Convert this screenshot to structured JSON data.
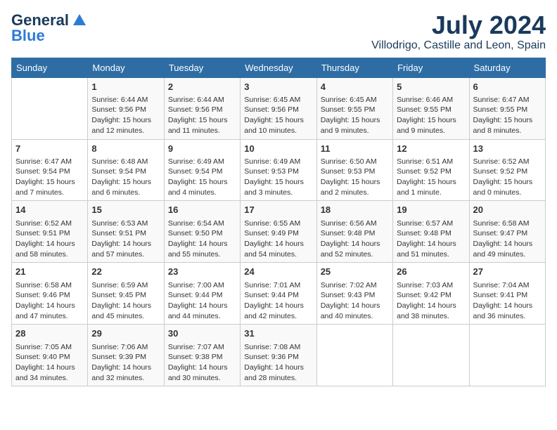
{
  "header": {
    "logo_line1": "General",
    "logo_line2": "Blue",
    "month": "July 2024",
    "location": "Villodrigo, Castille and Leon, Spain"
  },
  "days_of_week": [
    "Sunday",
    "Monday",
    "Tuesday",
    "Wednesday",
    "Thursday",
    "Friday",
    "Saturday"
  ],
  "weeks": [
    [
      {
        "day": "",
        "content": ""
      },
      {
        "day": "1",
        "content": "Sunrise: 6:44 AM\nSunset: 9:56 PM\nDaylight: 15 hours\nand 12 minutes."
      },
      {
        "day": "2",
        "content": "Sunrise: 6:44 AM\nSunset: 9:56 PM\nDaylight: 15 hours\nand 11 minutes."
      },
      {
        "day": "3",
        "content": "Sunrise: 6:45 AM\nSunset: 9:56 PM\nDaylight: 15 hours\nand 10 minutes."
      },
      {
        "day": "4",
        "content": "Sunrise: 6:45 AM\nSunset: 9:55 PM\nDaylight: 15 hours\nand 9 minutes."
      },
      {
        "day": "5",
        "content": "Sunrise: 6:46 AM\nSunset: 9:55 PM\nDaylight: 15 hours\nand 9 minutes."
      },
      {
        "day": "6",
        "content": "Sunrise: 6:47 AM\nSunset: 9:55 PM\nDaylight: 15 hours\nand 8 minutes."
      }
    ],
    [
      {
        "day": "7",
        "content": "Sunrise: 6:47 AM\nSunset: 9:54 PM\nDaylight: 15 hours\nand 7 minutes."
      },
      {
        "day": "8",
        "content": "Sunrise: 6:48 AM\nSunset: 9:54 PM\nDaylight: 15 hours\nand 6 minutes."
      },
      {
        "day": "9",
        "content": "Sunrise: 6:49 AM\nSunset: 9:54 PM\nDaylight: 15 hours\nand 4 minutes."
      },
      {
        "day": "10",
        "content": "Sunrise: 6:49 AM\nSunset: 9:53 PM\nDaylight: 15 hours\nand 3 minutes."
      },
      {
        "day": "11",
        "content": "Sunrise: 6:50 AM\nSunset: 9:53 PM\nDaylight: 15 hours\nand 2 minutes."
      },
      {
        "day": "12",
        "content": "Sunrise: 6:51 AM\nSunset: 9:52 PM\nDaylight: 15 hours\nand 1 minute."
      },
      {
        "day": "13",
        "content": "Sunrise: 6:52 AM\nSunset: 9:52 PM\nDaylight: 15 hours\nand 0 minutes."
      }
    ],
    [
      {
        "day": "14",
        "content": "Sunrise: 6:52 AM\nSunset: 9:51 PM\nDaylight: 14 hours\nand 58 minutes."
      },
      {
        "day": "15",
        "content": "Sunrise: 6:53 AM\nSunset: 9:51 PM\nDaylight: 14 hours\nand 57 minutes."
      },
      {
        "day": "16",
        "content": "Sunrise: 6:54 AM\nSunset: 9:50 PM\nDaylight: 14 hours\nand 55 minutes."
      },
      {
        "day": "17",
        "content": "Sunrise: 6:55 AM\nSunset: 9:49 PM\nDaylight: 14 hours\nand 54 minutes."
      },
      {
        "day": "18",
        "content": "Sunrise: 6:56 AM\nSunset: 9:48 PM\nDaylight: 14 hours\nand 52 minutes."
      },
      {
        "day": "19",
        "content": "Sunrise: 6:57 AM\nSunset: 9:48 PM\nDaylight: 14 hours\nand 51 minutes."
      },
      {
        "day": "20",
        "content": "Sunrise: 6:58 AM\nSunset: 9:47 PM\nDaylight: 14 hours\nand 49 minutes."
      }
    ],
    [
      {
        "day": "21",
        "content": "Sunrise: 6:58 AM\nSunset: 9:46 PM\nDaylight: 14 hours\nand 47 minutes."
      },
      {
        "day": "22",
        "content": "Sunrise: 6:59 AM\nSunset: 9:45 PM\nDaylight: 14 hours\nand 45 minutes."
      },
      {
        "day": "23",
        "content": "Sunrise: 7:00 AM\nSunset: 9:44 PM\nDaylight: 14 hours\nand 44 minutes."
      },
      {
        "day": "24",
        "content": "Sunrise: 7:01 AM\nSunset: 9:44 PM\nDaylight: 14 hours\nand 42 minutes."
      },
      {
        "day": "25",
        "content": "Sunrise: 7:02 AM\nSunset: 9:43 PM\nDaylight: 14 hours\nand 40 minutes."
      },
      {
        "day": "26",
        "content": "Sunrise: 7:03 AM\nSunset: 9:42 PM\nDaylight: 14 hours\nand 38 minutes."
      },
      {
        "day": "27",
        "content": "Sunrise: 7:04 AM\nSunset: 9:41 PM\nDaylight: 14 hours\nand 36 minutes."
      }
    ],
    [
      {
        "day": "28",
        "content": "Sunrise: 7:05 AM\nSunset: 9:40 PM\nDaylight: 14 hours\nand 34 minutes."
      },
      {
        "day": "29",
        "content": "Sunrise: 7:06 AM\nSunset: 9:39 PM\nDaylight: 14 hours\nand 32 minutes."
      },
      {
        "day": "30",
        "content": "Sunrise: 7:07 AM\nSunset: 9:38 PM\nDaylight: 14 hours\nand 30 minutes."
      },
      {
        "day": "31",
        "content": "Sunrise: 7:08 AM\nSunset: 9:36 PM\nDaylight: 14 hours\nand 28 minutes."
      },
      {
        "day": "",
        "content": ""
      },
      {
        "day": "",
        "content": ""
      },
      {
        "day": "",
        "content": ""
      }
    ]
  ]
}
